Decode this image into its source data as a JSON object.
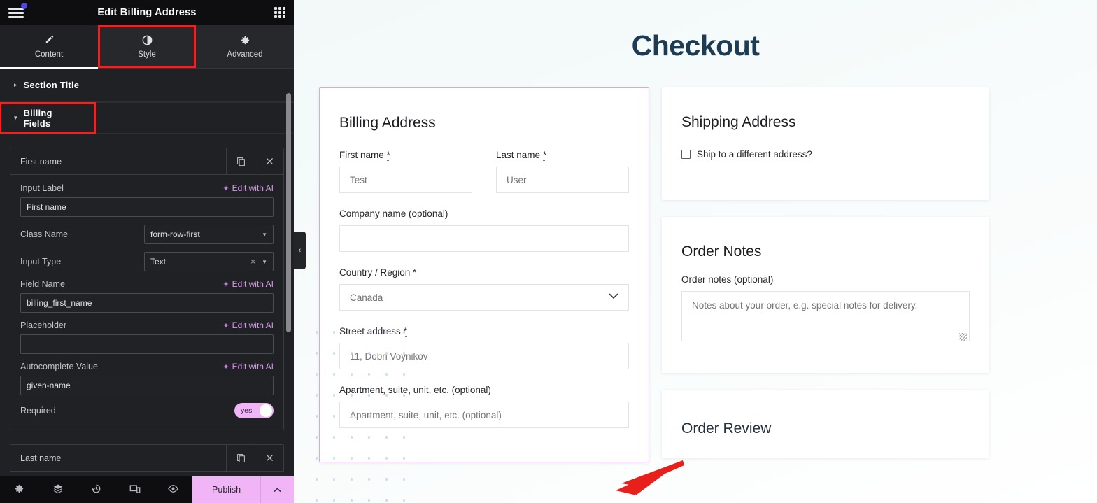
{
  "editor": {
    "header": {
      "title": "Edit Billing Address",
      "menu_icon": "hamburger-menu-icon",
      "apps_icon": "grid-apps-icon"
    },
    "tabs": [
      {
        "label": "Content",
        "icon": "pencil-icon",
        "active": true,
        "highlighted": false
      },
      {
        "label": "Style",
        "icon": "contrast-icon",
        "active": false,
        "highlighted": true
      },
      {
        "label": "Advanced",
        "icon": "gear-icon",
        "active": false,
        "highlighted": false
      }
    ],
    "sections": [
      {
        "label": "Section Title",
        "expanded": false,
        "highlighted": false,
        "caret": "▸"
      },
      {
        "label": "Billing Fields",
        "expanded": true,
        "highlighted": true,
        "caret": "▾"
      }
    ],
    "field_items": [
      {
        "name": "First name",
        "duplicate_icon": "duplicate-icon",
        "remove_icon": "close-icon",
        "controls": {
          "input_label": {
            "label": "Input Label",
            "value": "First name",
            "ai": "Edit with AI"
          },
          "class_name": {
            "label": "Class Name",
            "value": "form-row-first"
          },
          "input_type": {
            "label": "Input Type",
            "value": "Text",
            "clear": "×"
          },
          "field_name": {
            "label": "Field Name",
            "value": "billing_first_name",
            "ai": "Edit with AI"
          },
          "placeholder": {
            "label": "Placeholder",
            "value": "",
            "ai": "Edit with AI"
          },
          "autocomplete": {
            "label": "Autocomplete Value",
            "value": "given-name",
            "ai": "Edit with AI"
          },
          "required": {
            "label": "Required",
            "value": "yes"
          }
        }
      },
      {
        "name": "Last name",
        "duplicate_icon": "duplicate-icon",
        "remove_icon": "close-icon"
      }
    ],
    "footer": {
      "icons": [
        "gear-icon",
        "layers-icon",
        "history-icon",
        "responsive-icon",
        "preview-eye-icon"
      ],
      "publish_label": "Publish",
      "publish_caret": "⌃"
    },
    "collapse_handle": "‹"
  },
  "preview": {
    "page_title": "Checkout",
    "billing": {
      "heading": "Billing Address",
      "fields": {
        "first_name": {
          "label": "First name",
          "required": true,
          "placeholder": "Test"
        },
        "last_name": {
          "label": "Last name",
          "required": true,
          "placeholder": "User"
        },
        "company": {
          "label": "Company name (optional)",
          "required": false,
          "placeholder": ""
        },
        "country": {
          "label": "Country / Region",
          "required": true,
          "value": "Canada",
          "chevron": "⌄"
        },
        "street": {
          "label": "Street address",
          "required": true,
          "placeholder": "11, Dobri Voynikov"
        },
        "apartment": {
          "label": "Apartment, suite, unit, etc. (optional)",
          "required": false,
          "placeholder": "Apartment, suite, unit, etc. (optional)"
        }
      }
    },
    "shipping": {
      "heading": "Shipping Address",
      "checkbox_label": "Ship to a different address?",
      "checked": false
    },
    "order_notes": {
      "heading": "Order Notes",
      "label": "Order notes (optional)",
      "placeholder": "Notes about your order, e.g. special notes for delivery."
    },
    "order_review": {
      "heading": "Order Review"
    }
  },
  "colors": {
    "accent_pink": "#f0b4f7",
    "highlight_red": "#f22020",
    "title_navy": "#1d3c53",
    "selected_border": "#dba8dd",
    "ai_purple": "#d89ae8"
  }
}
